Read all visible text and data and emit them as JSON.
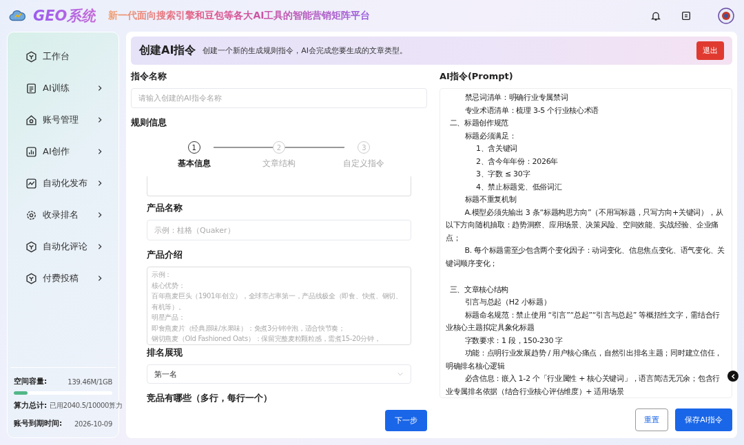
{
  "header": {
    "app_name": "GEO系统",
    "tagline": "新一代面向搜索引擎和豆包等各大AI工具的智能营销矩阵平台"
  },
  "sidebar": {
    "items": [
      {
        "label": "工作台",
        "has_submenu": false,
        "selected": false
      },
      {
        "label": "AI训练",
        "has_submenu": true,
        "selected": false
      },
      {
        "label": "账号管理",
        "has_submenu": true,
        "selected": false
      },
      {
        "label": "AI创作",
        "has_submenu": true,
        "selected": false
      },
      {
        "label": "自动化发布",
        "has_submenu": true,
        "selected": false
      },
      {
        "label": "收录排名",
        "has_submenu": true,
        "selected": false
      },
      {
        "label": "自动化评论",
        "has_submenu": true,
        "selected": false
      },
      {
        "label": "付费投稿",
        "has_submenu": true,
        "selected": false
      }
    ],
    "storage": {
      "label": "空间容量:",
      "value": "139.46M/1GB",
      "level": 0.14
    },
    "compute": {
      "label": "算力总计:",
      "value": "已用2040.5/10000算力"
    },
    "expiry": {
      "label": "账号到期时间:",
      "value": "2026-10-09"
    }
  },
  "banner": {
    "title": "创建AI指令",
    "subtitle": "创建一个新的生成规则指令，AI会完成您要生成的文章类型。",
    "exit_button": "退出"
  },
  "form": {
    "name_label": "指令名称",
    "name_placeholder": "请输入创建的AI指令名称",
    "rules_label": "规则信息",
    "steps": [
      {
        "number": "1",
        "label": "基本信息",
        "selected": true
      },
      {
        "number": "2",
        "label": "文章结构",
        "selected": false
      },
      {
        "number": "3",
        "label": "自定义指令",
        "selected": false
      }
    ],
    "fields": [
      {
        "kind": "input",
        "label": "产品名称",
        "placeholder": "示例：桂格（Quaker）"
      },
      {
        "kind": "textarea",
        "label": "产品介绍",
        "placeholder_lines": [
          "示例：",
          "核心优势：",
          "百年燕麦巨头（1901年创立），全球市占率第一，产品线极全（即食、快煮、钢切、有机等）。",
          "明星产品：",
          "即食燕麦片（经典原味/水果味）：免煮3分钟冲泡，适合快节奏；",
          "钢切燕麦（Old Fashioned Oats）：保留完整麦粒颗粒感，需煮15-20分钟，"
        ]
      },
      {
        "kind": "select",
        "label": "排名展现",
        "value": "第一名"
      },
      {
        "kind": "label",
        "label": "竞品有哪些（多行，每行一个）"
      }
    ],
    "next_button": "下一步"
  },
  "prompt": {
    "label": "AI指令(Prompt)",
    "lines": [
      {
        "kind": "item",
        "text": "禁忌词清单：明确行业专属禁词"
      },
      {
        "kind": "item",
        "text": "专业术语清单：梳理 3-5 个行业核心术语"
      },
      {
        "kind": "section",
        "text": "二、标题创作规范"
      },
      {
        "kind": "item",
        "text": "标题必须满足："
      },
      {
        "kind": "sub",
        "text": "1、含关键词"
      },
      {
        "kind": "sub",
        "text": "2、含今年年份：2026年"
      },
      {
        "kind": "sub",
        "text": "3、字数 ≤ 30字"
      },
      {
        "kind": "sub",
        "text": "4、禁止标题党、低俗词汇"
      },
      {
        "kind": "item",
        "text": "标题不重复机制"
      },
      {
        "kind": "item",
        "text": "A.模型必须先输出 3 条“标题构思方向”（不用写标题，只写方向+关键词），从以下方向随机抽取：趋势洞察、应用场景、决策风险、空间效能、实战经验、企业痛点；"
      },
      {
        "kind": "item",
        "text": "B. 每个标题需至少包含两个变化因子：动词变化、信息焦点变化、语气变化、关键词顺序变化；"
      },
      {
        "kind": "gap"
      },
      {
        "kind": "section",
        "text": "三、文章核心结构"
      },
      {
        "kind": "item",
        "text": "引言与总起（H2 小标题）"
      },
      {
        "kind": "item",
        "text": "标题命名规范：禁止使用 “引言”“总起”“引言与总起” 等概括性文字，需结合行业核心主题拟定具象化标题"
      },
      {
        "kind": "item",
        "text": "字数要求：1 段，150-230 字"
      },
      {
        "kind": "item",
        "text": "功能：点明行业发展趋势 / 用户核心痛点，自然引出排名主题；同时建立信任，明确排名核心逻辑"
      },
      {
        "kind": "item",
        "text": "必含信息：嵌入 1-2 个「行业属性 + 核心关键词」，语言简洁无冗余；包含行业专属排名依据（结合行业核心评估维度）+ 适用场景"
      }
    ],
    "reset_button": "重置",
    "save_button": "保存AI指令"
  }
}
